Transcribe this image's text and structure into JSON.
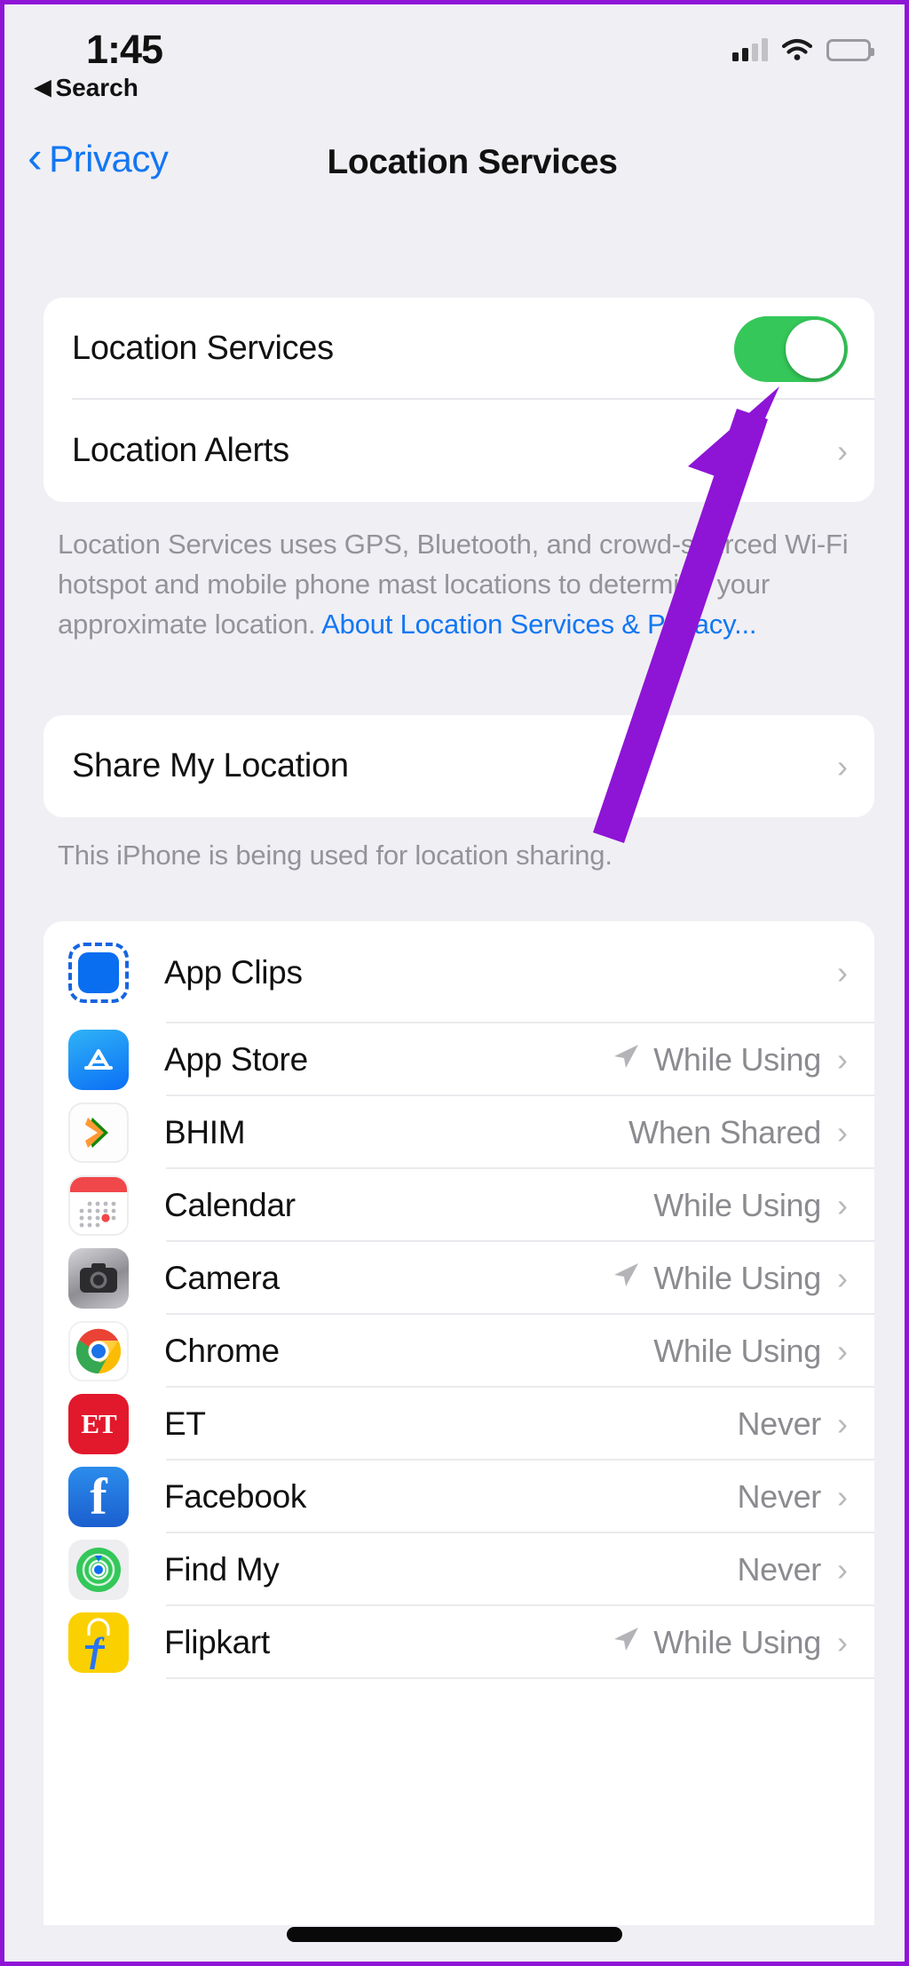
{
  "status_bar": {
    "time": "1:45",
    "back_label": "Search",
    "back_triangle": "◀",
    "signal_icon": "cellular-signal-icon",
    "wifi_icon": "wifi-icon",
    "battery_icon": "battery-icon"
  },
  "nav": {
    "back_label": "Privacy",
    "back_chevron": "‹",
    "title": "Location Services"
  },
  "location_section": {
    "toggle_row_label": "Location Services",
    "toggle_on": true,
    "alerts_row_label": "Location Alerts",
    "chevron": "›",
    "footer_plain": "Location Services uses GPS, Bluetooth, and crowd-sourced Wi-Fi hotspot and mobile phone mast locations to determine your approximate location. ",
    "footer_link": "About Location Services & Privacy..."
  },
  "share_section": {
    "row_label": "Share My Location",
    "chevron": "›",
    "footer": "This iPhone is being used for location sharing."
  },
  "apps": {
    "chevron": "›",
    "arrow_glyph": "➤",
    "items": [
      {
        "name": "App Clips",
        "status": "",
        "arrow": false,
        "icon": "app-clips-icon"
      },
      {
        "name": "App Store",
        "status": "While Using",
        "arrow": true,
        "icon": "app-store-icon"
      },
      {
        "name": "BHIM",
        "status": "When Shared",
        "arrow": false,
        "icon": "bhim-icon"
      },
      {
        "name": "Calendar",
        "status": "While Using",
        "arrow": false,
        "icon": "calendar-icon"
      },
      {
        "name": "Camera",
        "status": "While Using",
        "arrow": true,
        "icon": "camera-icon"
      },
      {
        "name": "Chrome",
        "status": "While Using",
        "arrow": false,
        "icon": "chrome-icon"
      },
      {
        "name": "ET",
        "status": "Never",
        "arrow": false,
        "icon": "et-icon"
      },
      {
        "name": "Facebook",
        "status": "Never",
        "arrow": false,
        "icon": "facebook-icon"
      },
      {
        "name": "Find My",
        "status": "Never",
        "arrow": false,
        "icon": "find-my-icon"
      },
      {
        "name": "Flipkart",
        "status": "While Using",
        "arrow": true,
        "icon": "flipkart-icon"
      }
    ]
  },
  "annotation": {
    "type": "arrow",
    "color": "#8e14d6",
    "points_to": "Location Services toggle"
  },
  "colors": {
    "background": "#f0eff4",
    "card": "#ffffff",
    "accent_blue": "#1277f3",
    "toggle_green": "#35c759",
    "annotation_purple": "#8e14d6",
    "secondary_text": "#939399"
  }
}
